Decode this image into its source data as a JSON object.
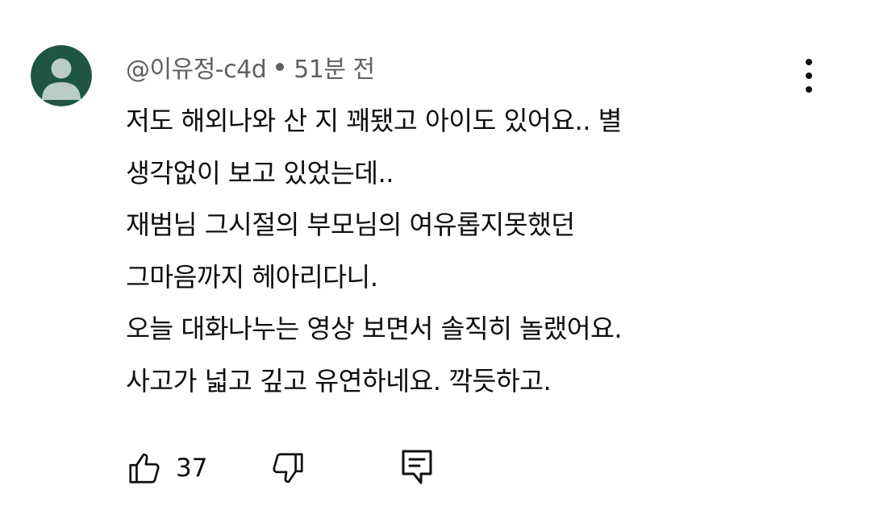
{
  "comment": {
    "author": "@이유정-c4d",
    "time": "51분 전",
    "lines": [
      "저도 해외나와 산 지 꽤됐고 아이도 있어요.. 별",
      "생각없이 보고 있었는데..",
      "재범님 그시절의 부모님의 여유롭지못했던",
      "그마음까지 헤아리다니.",
      "오늘 대화나누는 영상 보면서 솔직히 놀랬어요.",
      "사고가 넓고 깊고 유연하네요. 깍듯하고."
    ],
    "like_count": "37",
    "avatar_color": "#1e5545",
    "avatar_figure_color": "#b9ccc6"
  },
  "icons": {
    "avatar": "avatar-person-icon",
    "more": "more-vertical-icon",
    "like": "thumbs-up-icon",
    "dislike": "thumbs-down-icon",
    "reply": "reply-comment-icon"
  }
}
